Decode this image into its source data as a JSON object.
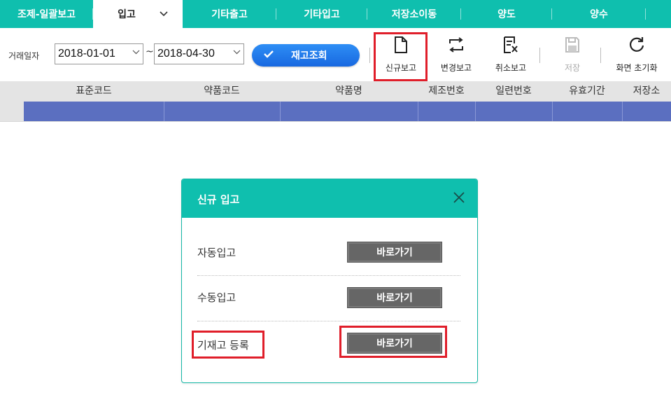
{
  "tabs": [
    {
      "label": "조제-일괄보고",
      "active": false
    },
    {
      "label": "입고",
      "active": true,
      "dropdown": "chevron-down-icon"
    },
    {
      "label": "기타출고",
      "active": false
    },
    {
      "label": "기타입고",
      "active": false
    },
    {
      "label": "저장소이동",
      "active": false
    },
    {
      "label": "양도",
      "active": false
    },
    {
      "label": "양수",
      "active": false
    }
  ],
  "filter": {
    "date_label": "거래일자",
    "start_date": "2018-01-01",
    "end_date": "2018-04-30",
    "separator": "~",
    "query_button": "재고조회"
  },
  "toolbar": {
    "new_report": "신규보고",
    "change_report": "변경보고",
    "cancel_report": "취소보고",
    "save": "저장",
    "reset_screen": "화면 초기화"
  },
  "grid": {
    "columns": [
      "표준코드",
      "약품코드",
      "약품명",
      "제조번호",
      "일련번호",
      "유효기간",
      "저장소"
    ]
  },
  "modal": {
    "title": "신규 입고",
    "rows": [
      {
        "label": "자동입고",
        "button": "바로가기"
      },
      {
        "label": "수동입고",
        "button": "바로가기"
      },
      {
        "label": "기재고 등록",
        "button": "바로가기"
      }
    ]
  },
  "colors": {
    "brand": "#0fbfae",
    "primary_button": "#1f78ea",
    "grid_selected_row": "#5b6fc0",
    "highlight": "#e01e2a",
    "go_button": "#666666"
  }
}
